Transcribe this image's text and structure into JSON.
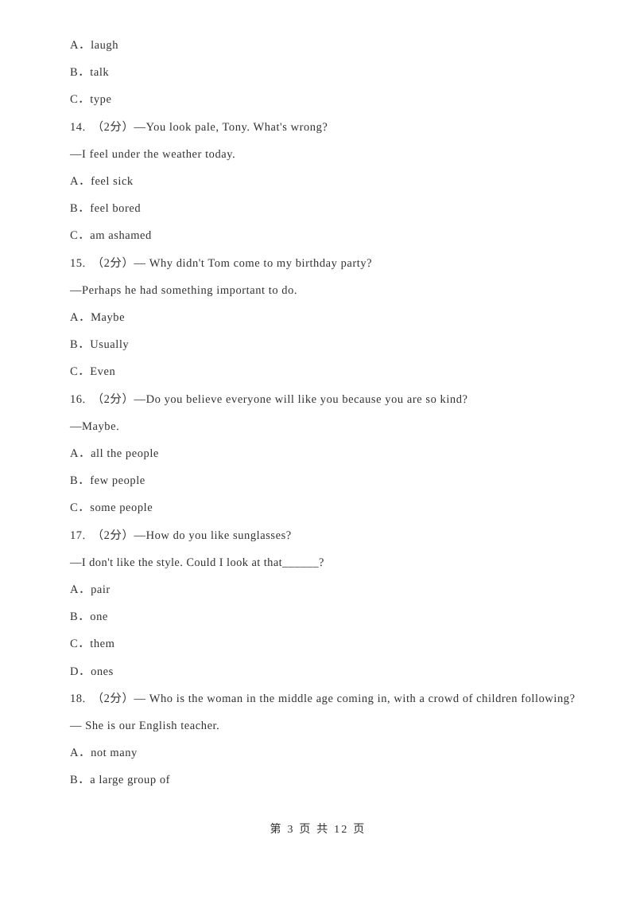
{
  "document": {
    "type": "exam-worksheet",
    "language": "zh-CN + en",
    "background_color": "#ffffff",
    "text_color": "#313131"
  },
  "body_lines": [
    {
      "id": "opt-13-a",
      "text": "A．laugh",
      "style": "indent"
    },
    {
      "id": "opt-13-b",
      "text": "B．talk",
      "style": "indent"
    },
    {
      "id": "opt-13-c",
      "text": "C．type",
      "style": "indent"
    },
    {
      "id": "q-14",
      "text": "14.　（2分）—You look pale, Tony. What's wrong?",
      "style": "indent"
    },
    {
      "id": "q-14-reply",
      "text": "—I feel under the weather today.",
      "style": "indent"
    },
    {
      "id": "opt-14-a",
      "text": "A．feel sick",
      "style": "indent"
    },
    {
      "id": "opt-14-b",
      "text": "B．feel bored",
      "style": "indent"
    },
    {
      "id": "opt-14-c",
      "text": "C．am ashamed",
      "style": "indent"
    },
    {
      "id": "q-15",
      "text": "15.　（2分）— Why didn't Tom come to my birthday party?",
      "style": "indent"
    },
    {
      "id": "q-15-reply",
      "text": "—Perhaps he had something important to do.",
      "style": "indent"
    },
    {
      "id": "opt-15-a",
      "text": "A．Maybe",
      "style": "indent"
    },
    {
      "id": "opt-15-b",
      "text": "B．Usually",
      "style": "indent"
    },
    {
      "id": "opt-15-c",
      "text": "C．Even",
      "style": "indent"
    },
    {
      "id": "q-16",
      "text": "16.　（2分）—Do you believe everyone will like you because you are so kind?",
      "style": "indent"
    },
    {
      "id": "q-16-reply",
      "text": "—Maybe.",
      "style": "indent"
    },
    {
      "id": "opt-16-a",
      "text": "A．all the people",
      "style": "indent"
    },
    {
      "id": "opt-16-b",
      "text": "B．few people",
      "style": "indent"
    },
    {
      "id": "opt-16-c",
      "text": "C．some people",
      "style": "indent"
    },
    {
      "id": "q-17",
      "text": "17.　（2分）—How do you like sunglasses?",
      "style": "indent"
    },
    {
      "id": "q-17-reply",
      "text": "—I don't like the style. Could I look at that______?",
      "style": "indent"
    },
    {
      "id": "opt-17-a",
      "text": "A．pair",
      "style": "indent"
    },
    {
      "id": "opt-17-b",
      "text": "B．one",
      "style": "indent"
    },
    {
      "id": "opt-17-c",
      "text": "C．them",
      "style": "indent"
    },
    {
      "id": "opt-17-d",
      "text": "D．ones",
      "style": "indent"
    },
    {
      "id": "q-18",
      "text": "18.　（2分）— Who is the woman in the middle age coming in, with a crowd of children following?",
      "style": "qwrap"
    },
    {
      "id": "q-18-reply",
      "text": "— She is our English teacher.",
      "style": "indent"
    },
    {
      "id": "opt-18-a",
      "text": "A．not many",
      "style": "indent"
    },
    {
      "id": "opt-18-b",
      "text": "B．a large group of",
      "style": "indent"
    }
  ],
  "footer": {
    "text": "第 3 页 共 12 页",
    "current_page": 3,
    "total_pages": 12
  }
}
